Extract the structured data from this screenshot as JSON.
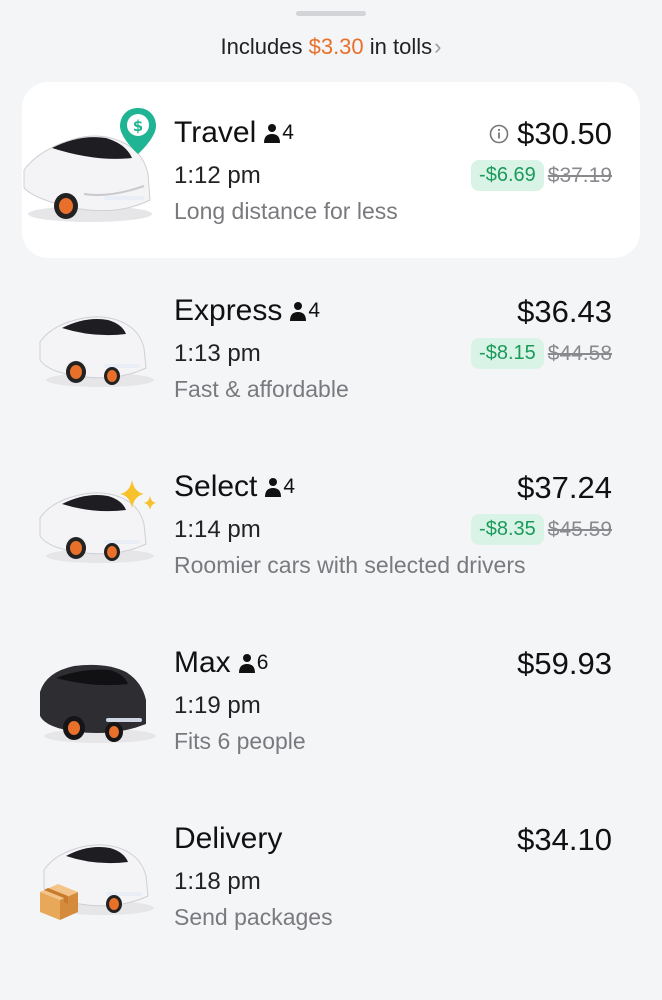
{
  "header": {
    "tolls_prefix": "Includes ",
    "tolls_amount": "$3.30",
    "tolls_suffix": " in tolls",
    "tolls_chevron": "›"
  },
  "colors": {
    "accent_orange": "#e8702a",
    "discount_bg": "#d9f4e6",
    "discount_text": "#1b9a5a",
    "location_pin": "#1fb594",
    "sparkle": "#f6c12b"
  },
  "options": [
    {
      "name": "Travel",
      "seats": "4",
      "time": "1:12 pm",
      "description": "Long distance for less",
      "price": "$30.50",
      "discount": "-$6.69",
      "original_price": "$37.19",
      "selected": true,
      "badge_icon": "dollar-location-pin-icon",
      "car": "white-sedan"
    },
    {
      "name": "Express",
      "seats": "4",
      "time": "1:13 pm",
      "description": "Fast & affordable",
      "price": "$36.43",
      "discount": "-$8.15",
      "original_price": "$44.58",
      "car": "white-sedan"
    },
    {
      "name": "Select",
      "seats": "4",
      "time": "1:14 pm",
      "description": "Roomier cars with selected drivers",
      "price": "$37.24",
      "discount": "-$8.35",
      "original_price": "$45.59",
      "badge_icon": "sparkle-icon",
      "car": "white-sedan"
    },
    {
      "name": "Max",
      "seats": "6",
      "time": "1:19 pm",
      "description": "Fits 6 people",
      "price": "$59.93",
      "car": "black-suv"
    },
    {
      "name": "Delivery",
      "time": "1:18 pm",
      "description": "Send packages",
      "price": "$34.10",
      "badge_icon": "package-box-icon",
      "car": "white-sedan"
    }
  ]
}
